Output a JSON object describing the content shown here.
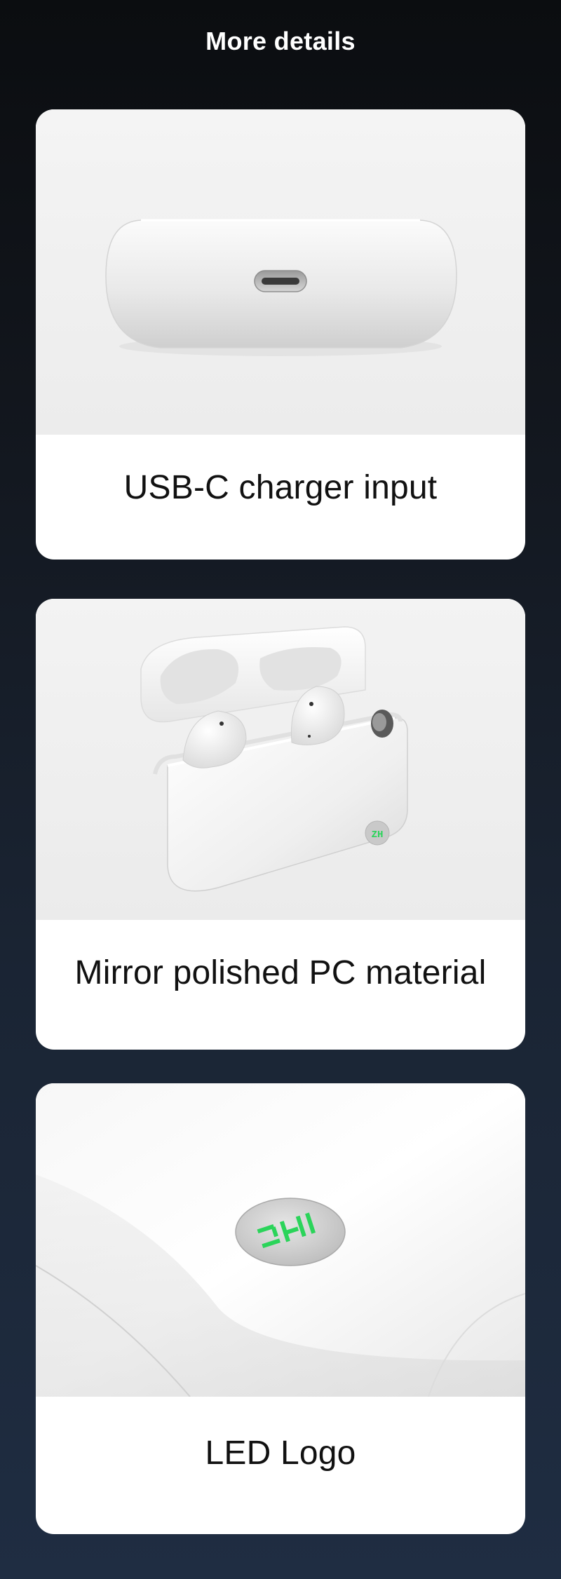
{
  "header": {
    "title": "More details"
  },
  "cards": [
    {
      "caption": "USB-C charger input",
      "image": "charging-case-usb-c-port"
    },
    {
      "caption": "Mirror polished PC material",
      "image": "open-charging-case-with-earbuds"
    },
    {
      "caption": "LED Logo",
      "image": "led-logo-closeup"
    }
  ],
  "brand": {
    "logo_glyph": "ZH",
    "led_color": "#2bd45a"
  },
  "colors": {
    "background_top": "#0b0d10",
    "background_bottom": "#1f2d42",
    "card": "#ffffff",
    "caption_text": "#111111"
  }
}
